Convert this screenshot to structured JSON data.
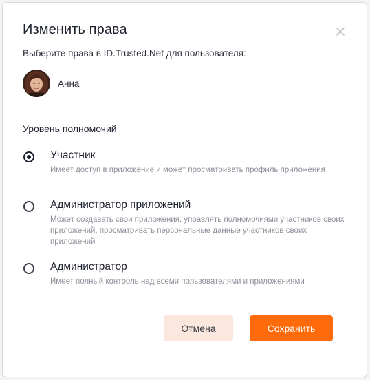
{
  "dialog": {
    "title": "Изменить права",
    "subtitle": "Выберите права в ID.Trusted.Net для пользователя:",
    "close_icon": "close-icon"
  },
  "user": {
    "name": "Анна",
    "avatar_icon": "user-avatar"
  },
  "roles": {
    "section_label": "Уровень полномочий",
    "selected": "member",
    "options": [
      {
        "id": "member",
        "label": "Участник",
        "description": "Имеет доступ в приложение и может просматривать профиль приложения",
        "checked": true
      },
      {
        "id": "app-admin",
        "label": "Администратор приложений",
        "description": "Может создавать свои приложения, управлять полномочиями участников своих приложений, просматривать персональные данные участников своих приложений",
        "checked": false
      },
      {
        "id": "admin",
        "label": "Администратор",
        "description": "Имеет полный контроль над всеми пользователями и приложениями",
        "checked": false
      }
    ]
  },
  "buttons": {
    "cancel_label": "Отмена",
    "save_label": "Сохранить"
  },
  "colors": {
    "accent": "#ff6b0a",
    "cancel_bg": "#fbe7dd",
    "text": "#1f2230",
    "muted": "#8d909a"
  }
}
